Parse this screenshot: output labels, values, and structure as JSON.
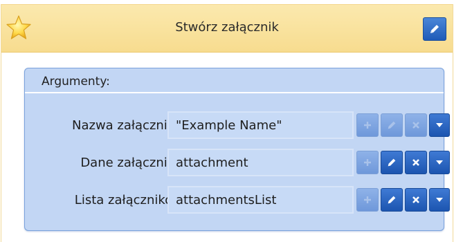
{
  "header": {
    "title": "Stwórz załącznik",
    "star_icon": "star-icon",
    "edit_icon": "pencil-icon"
  },
  "panel": {
    "title": "Argumenty:",
    "rows": [
      {
        "label": "Nazwa załącznika:",
        "value": "\"Example Name\"",
        "buttons_enabled": {
          "add": false,
          "edit": false,
          "delete": false,
          "menu": true
        }
      },
      {
        "label": "Dane załącznika:",
        "value": "attachment",
        "buttons_enabled": {
          "add": false,
          "edit": true,
          "delete": true,
          "menu": true
        }
      },
      {
        "label": "Lista załączników:",
        "value": "attachmentsList",
        "buttons_enabled": {
          "add": false,
          "edit": true,
          "delete": true,
          "menu": true
        }
      }
    ]
  },
  "colors": {
    "header_bg": "#f7dc8f",
    "panel_bg": "#c2d6f4",
    "button_active": "#1f5bb8",
    "button_disabled": "#7fa6e0"
  }
}
